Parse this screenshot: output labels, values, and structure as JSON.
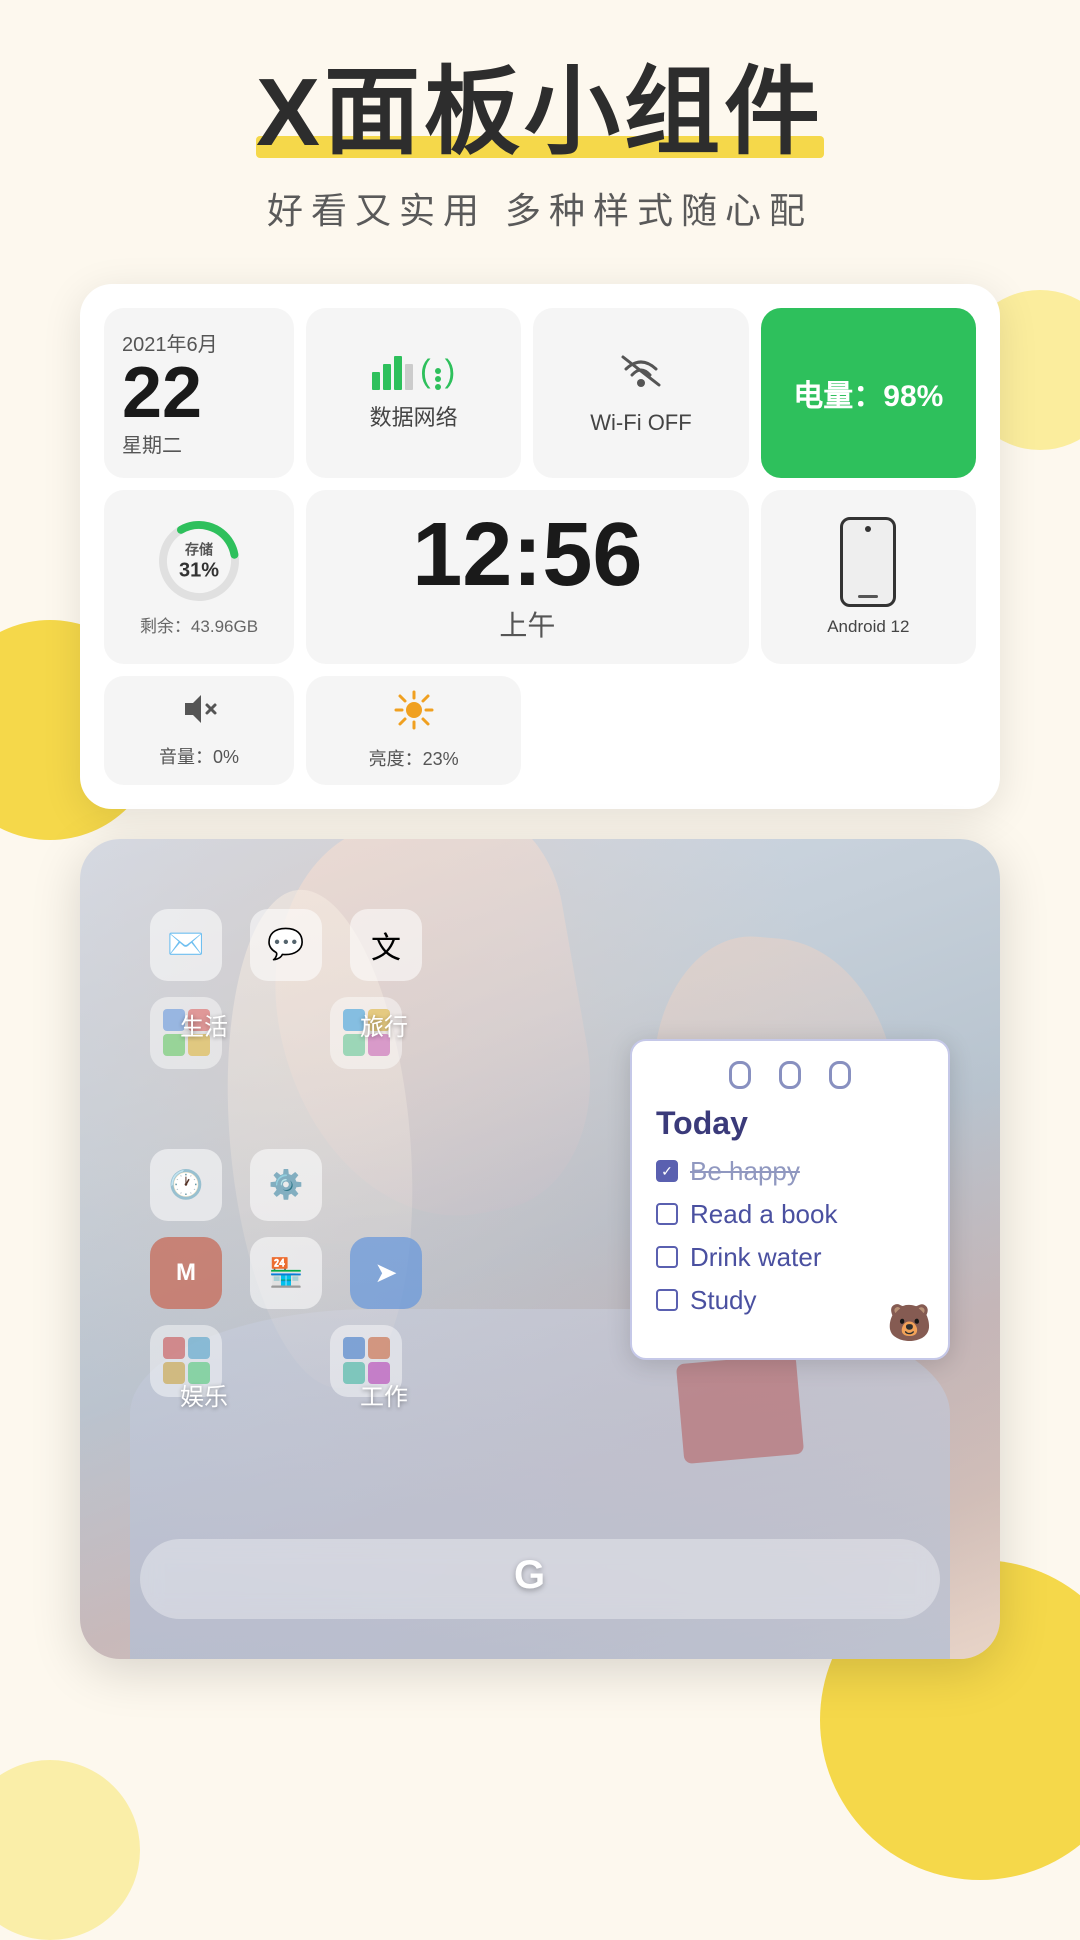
{
  "title": {
    "main": "X面板小组件",
    "highlight_text": "X面板小组件",
    "subtitle": "好看又实用  多种样式随心配"
  },
  "widget": {
    "date": {
      "year_month": "2021年6月",
      "day": "22",
      "weekday": "星期二"
    },
    "data_network": {
      "label": "数据网络"
    },
    "wifi": {
      "label": "Wi-Fi OFF"
    },
    "battery": {
      "label": "电量：98%"
    },
    "storage": {
      "percent": "存储\n31%",
      "percent_number": 31,
      "remaining": "剩余：43.96GB"
    },
    "time": {
      "display": "12:56",
      "ampm": "上午"
    },
    "volume": {
      "label": "音量：0%"
    },
    "brightness": {
      "label": "亮度：23%"
    },
    "android": {
      "label": "Android 12"
    }
  },
  "phone_screen": {
    "folders": [
      {
        "label": "生活"
      },
      {
        "label": "旅行"
      },
      {
        "label": "娱乐"
      },
      {
        "label": "工作"
      }
    ],
    "notebook": {
      "title": "Today",
      "items": [
        {
          "text": "Be happy",
          "checked": true,
          "strikethrough": true
        },
        {
          "text": "Read a book",
          "checked": false
        },
        {
          "text": "Drink water",
          "checked": false
        },
        {
          "text": "Study",
          "checked": false
        }
      ]
    },
    "bottom_bar_icon": "G"
  }
}
